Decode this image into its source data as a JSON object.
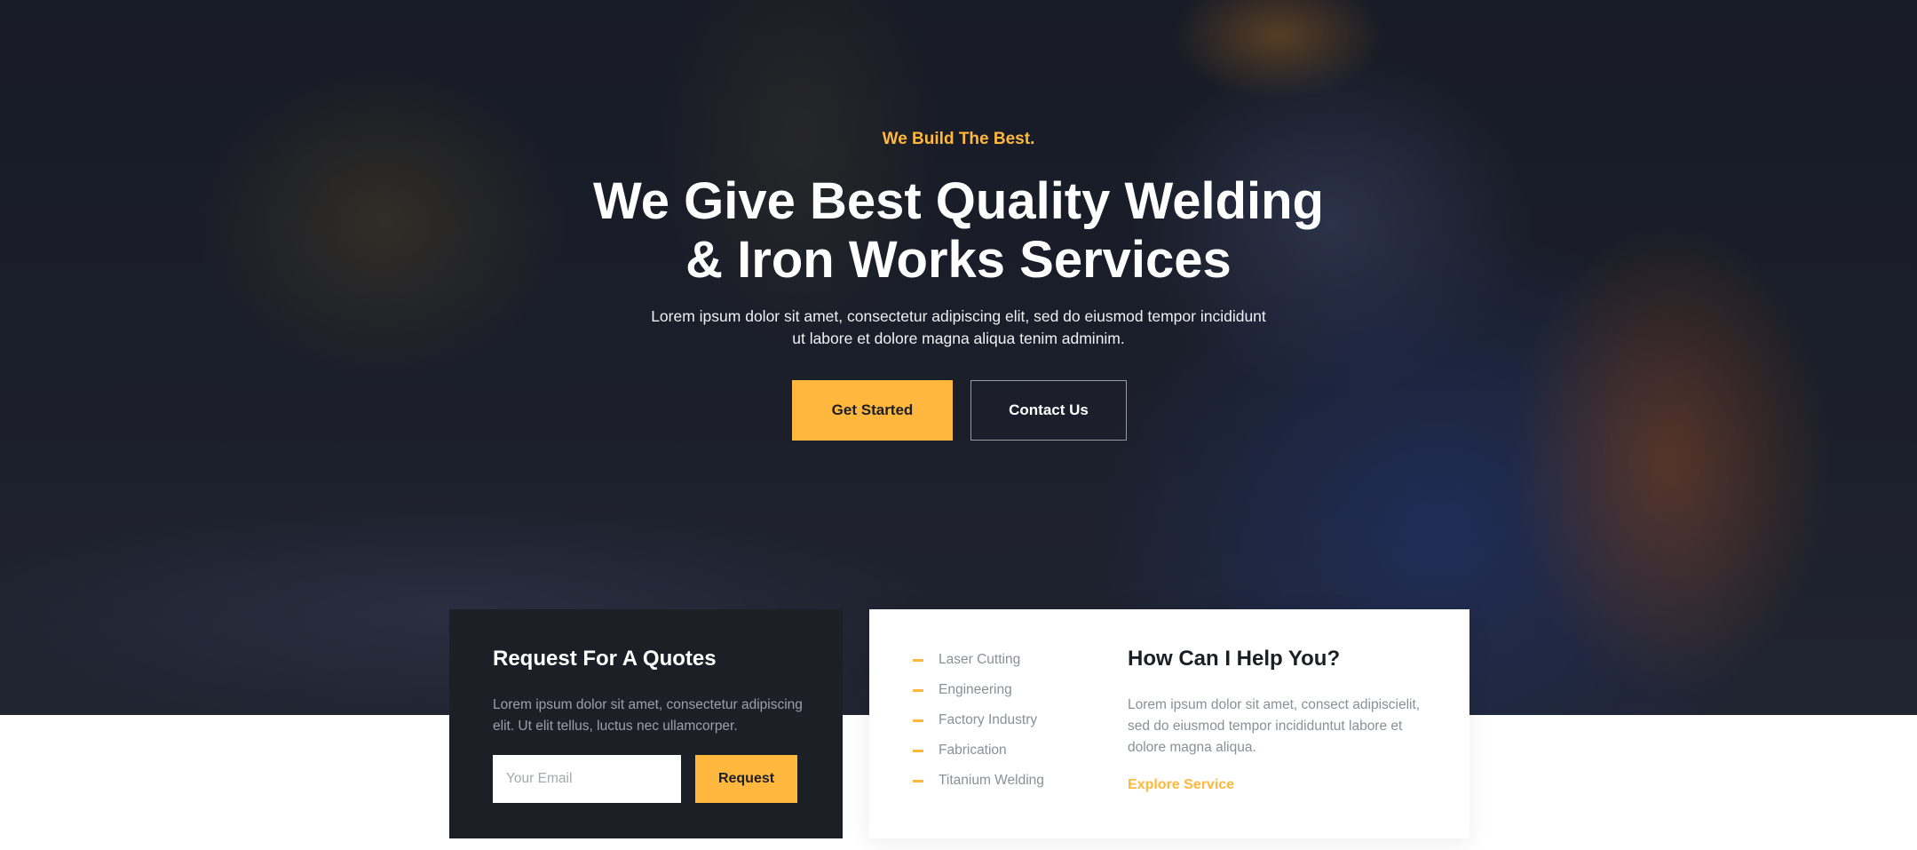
{
  "hero": {
    "tagline": "We Build The Best.",
    "title_line1": "We Give Best Quality Welding",
    "title_line2": "& Iron Works Services",
    "subtitle_line1": "Lorem ipsum dolor sit amet, consectetur adipiscing elit, sed do eiusmod tempor incididunt",
    "subtitle_line2": "ut labore et dolore magna aliqua tenim adminim.",
    "primary_button": "Get Started",
    "secondary_button": "Contact Us"
  },
  "quote_card": {
    "title": "Request For A Quotes",
    "text": "Lorem ipsum dolor sit amet, consectetur adipiscing elit. Ut elit tellus, luctus nec ullamcorper.",
    "email_placeholder": "Your Email",
    "email_value": "",
    "button": "Request"
  },
  "help_card": {
    "services": [
      "Laser Cutting",
      "Engineering",
      "Factory Industry",
      "Fabrication",
      "Titanium Welding"
    ],
    "title": "How Can I Help You?",
    "text": "Lorem ipsum dolor sit amet, consect adipiscielit, sed do eiusmod tempor incididuntut labore et dolore magna aliqua.",
    "link": "Explore Service"
  },
  "colors": {
    "accent": "#ffb83d",
    "dark": "#1d1f27",
    "muted_text": "#8a8f99"
  }
}
